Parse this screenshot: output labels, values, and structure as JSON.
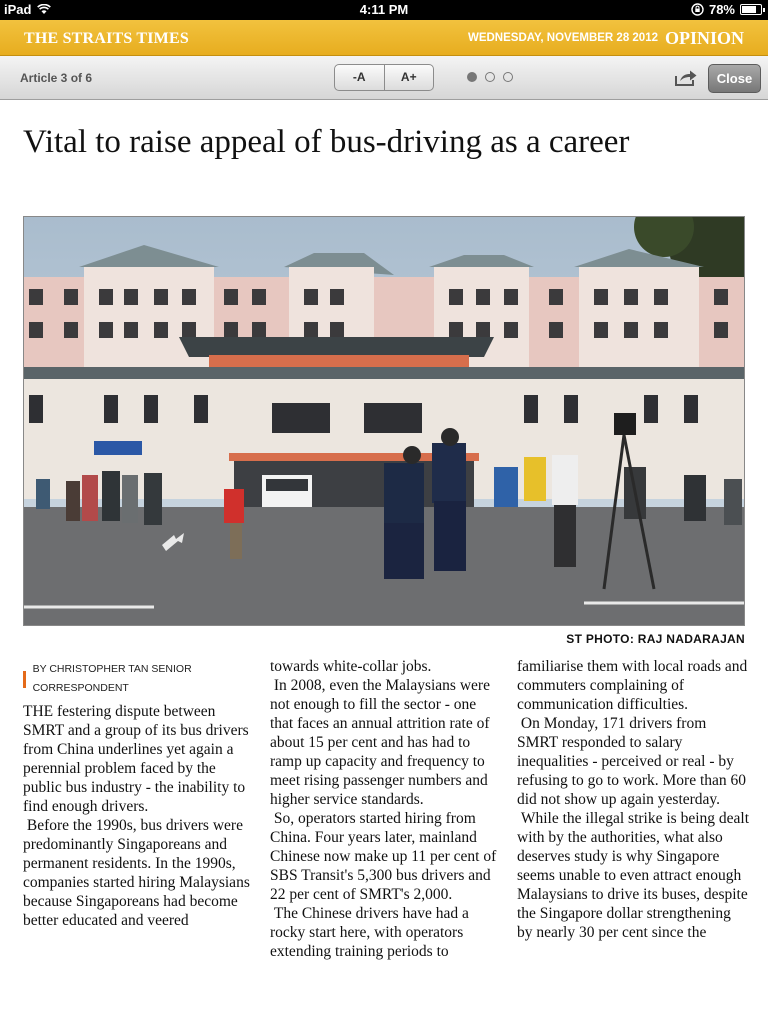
{
  "status_bar": {
    "device": "iPad",
    "time": "4:11 PM",
    "battery": "78%",
    "battery_level": 0.78
  },
  "masthead": {
    "brand": "THE STRAITS TIMES",
    "date": "WEDNESDAY, NOVEMBER 28 2012",
    "section": "OPINION"
  },
  "toolbar": {
    "article_counter": "Article 3 of 6",
    "font_decrease": "-A",
    "font_increase": "A+",
    "pages": 3,
    "current_page": 1,
    "close_label": "Close"
  },
  "article": {
    "headline": "Vital to raise appeal of bus-driving as a career",
    "photo_credit": "ST PHOTO: RAJ NADARAJAN",
    "byline": "BY CHRISTOPHER TAN SENIOR CORRESPONDENT",
    "columns": [
      [
        "THE festering dispute between SMRT and a group of its bus drivers from China underlines yet again a perennial problem faced by the public bus industry - the inability to find enough drivers.",
        " Before the 1990s, bus drivers were predominantly Singaporeans and permanent residents. In the 1990s, companies started hiring Malaysians because Singaporeans had become better educated and veered"
      ],
      [
        "towards white-collar jobs.",
        " In 2008, even the Malaysians were not enough to fill the sector - one that faces an annual attrition rate of about 15 per cent and has had to ramp up capacity and frequency to meet rising passenger numbers and higher service standards.",
        " So, operators started hiring from China. Four years later, mainland Chinese now make up 11 per cent of SBS Transit's 5,300 bus drivers and 22 per cent of SMRT's 2,000.",
        " The Chinese drivers have had a rocky start here, with operators extending training periods to"
      ],
      [
        "familiarise them with local roads and commuters complaining of communication difficulties.",
        " On Monday, 171 drivers from SMRT responded to salary inequalities - perceived or real - by refusing to go to work. More than 60 did not show up again yesterday.",
        " While the illegal strike is being dealt with by the authorities, what also deserves study is why Singapore seems unable to even attract enough Malaysians to drive its buses, despite the Singapore dollar strengthening by nearly 30 per cent since the"
      ]
    ]
  }
}
